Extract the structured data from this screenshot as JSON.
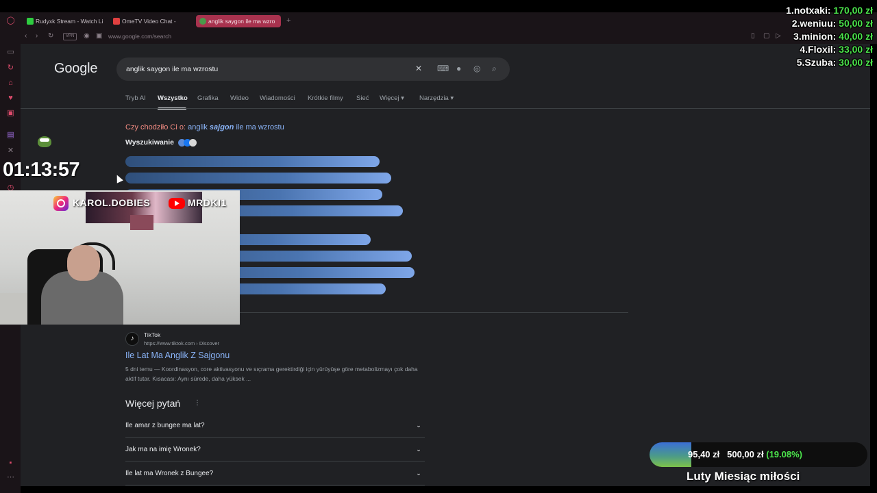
{
  "browser": {
    "tabs": [
      {
        "label": "Rudyxk Stream - Watch Li",
        "favicon_color": "#2ecc40"
      },
      {
        "label": "OmeTV Video Chat -",
        "favicon_color": "#e04040"
      },
      {
        "label": "anglik saygon ile ma wzro",
        "favicon_color": "#4a9a4a"
      }
    ],
    "vpn_label": "VPN",
    "url": "www.google.com/search"
  },
  "google": {
    "logo": "Google",
    "query": "anglik saygon ile ma wzrostu",
    "filters": [
      "Tryb AI",
      "Wszystko",
      "Grafika",
      "Wideo",
      "Wiadomości",
      "Krótkie filmy",
      "Sieć",
      "Więcej ▾",
      "Narzędzia ▾"
    ],
    "active_filter_index": 1,
    "did_you_mean": {
      "label": "Czy chodziło Ci o:",
      "before": "anglik",
      "emphasis": "sajgon",
      "after": "ile ma wzrostu"
    },
    "searching_label": "Wyszukiwanie",
    "result": {
      "site": "TikTok",
      "url": "https://www.tiktok.com › Discover",
      "title": "Ile Lat Ma Anglik Z Sajgonu",
      "snippet": "5 dni temu — Koordinasyon, core aktivasyonu ve sıçrama gerektirdiği için yürüyüşe göre metabolizmayı çok daha aktif tutar. Kısacası: Aynı sürede, daha yüksek ..."
    },
    "paa_title": "Więcej pytań",
    "paa_questions": [
      "Ile amar z bungee ma lat?",
      "Jak ma na imię Wronek?",
      "Ile lat ma Wronek z Bungee?"
    ]
  },
  "stream": {
    "timer": "01:13:57",
    "instagram_handle": "KAROL.DOBIES",
    "youtube_handle": "MRDKI1",
    "donors": [
      {
        "name": "1.notxaki:",
        "amount": "170,00 zł"
      },
      {
        "name": "2.weniuu:",
        "amount": "50,00 zł"
      },
      {
        "name": "3.minion:",
        "amount": "40,00 zł"
      },
      {
        "name": "4.Floxil:",
        "amount": "33,00 zł"
      },
      {
        "name": "5.Szuba:",
        "amount": "30,00 zł"
      }
    ],
    "goal": {
      "current": "95,40 zł",
      "target": "500,00 zł",
      "percent_label": "(19.08%)",
      "fraction": 0.1908,
      "title": "Luty Miesiąc miłości"
    }
  },
  "colors": {
    "accent_tab": "#a8324e",
    "link": "#8ab4f8",
    "donor_amount": "#4be34b"
  }
}
